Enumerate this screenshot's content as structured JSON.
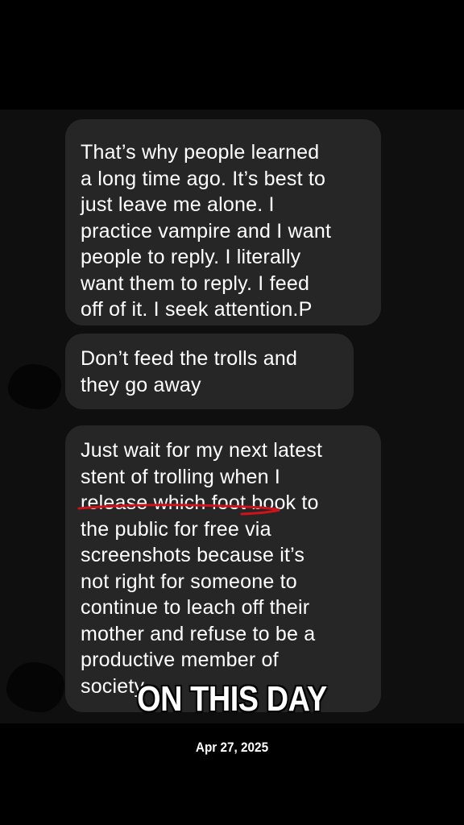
{
  "messages": [
    {
      "lines": [
        "That’s why people learned",
        "a long time ago. It’s best to",
        "just leave me alone. I",
        "practice vampire and I want",
        "people to reply. I literally",
        "want them to reply. I feed",
        "off of it. I seek attention.P"
      ]
    },
    {
      "lines": [
        "Don’t feed the trolls and",
        "they go away"
      ]
    },
    {
      "lines": [
        "Just wait for my next latest",
        "stent of trolling when I",
        "release which foot book to",
        "the public for free via",
        "screenshots because it’s",
        "not right for someone to",
        "continue to leach off their",
        "mother and refuse to be a",
        "productive member of",
        "society"
      ]
    }
  ],
  "overlay": {
    "title": "ON THIS DAY",
    "date": "Apr 27, 2025"
  },
  "colors": {
    "background": "#000000",
    "screenshot_background": "#0f0f0f",
    "bubble": "#262626",
    "text": "#ffffff",
    "annotation_underline": "#d0121b"
  }
}
